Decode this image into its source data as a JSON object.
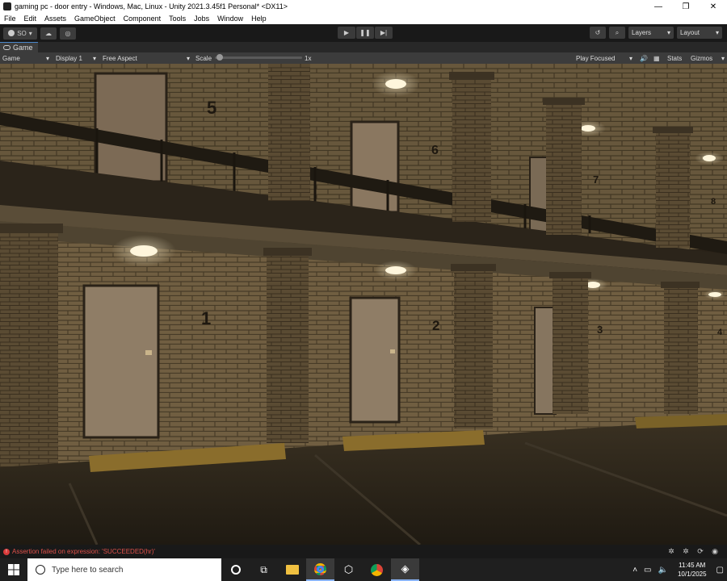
{
  "window": {
    "title": "gaming pc - door entry - Windows, Mac, Linux - Unity 2021.3.45f1 Personal* <DX11>",
    "controls": [
      "—",
      "❐",
      "✕"
    ]
  },
  "menu": [
    "File",
    "Edit",
    "Assets",
    "GameObject",
    "Component",
    "Tools",
    "Jobs",
    "Window",
    "Help"
  ],
  "toolbar": {
    "account_label": "SO",
    "layers_label": "Layers",
    "layout_label": "Layout"
  },
  "tabs": {
    "game_tab": "Game"
  },
  "gamebar": {
    "view_mode": "Game",
    "display": "Display 1",
    "aspect": "Free Aspect",
    "scale_label": "Scale",
    "scale_value": "1x",
    "scale_fraction": 0.02,
    "play_mode": "Play Focused",
    "stats": "Stats",
    "gizmos": "Gizmos"
  },
  "scene": {
    "upper_numbers": [
      "5",
      "6",
      "7",
      "8"
    ],
    "lower_numbers": [
      "1",
      "2",
      "3",
      "4"
    ]
  },
  "status": {
    "error_text": "Assertion failed on expression: 'SUCCEEDED(hr)'"
  },
  "taskbar": {
    "search_placeholder": "Type here to search",
    "time": "11:45 AM",
    "date": "10/1/2025"
  },
  "colors": {
    "editor_bg": "#191919",
    "error": "#e0514a",
    "wall": "#6b5a3e",
    "floor": "#2b2419"
  }
}
